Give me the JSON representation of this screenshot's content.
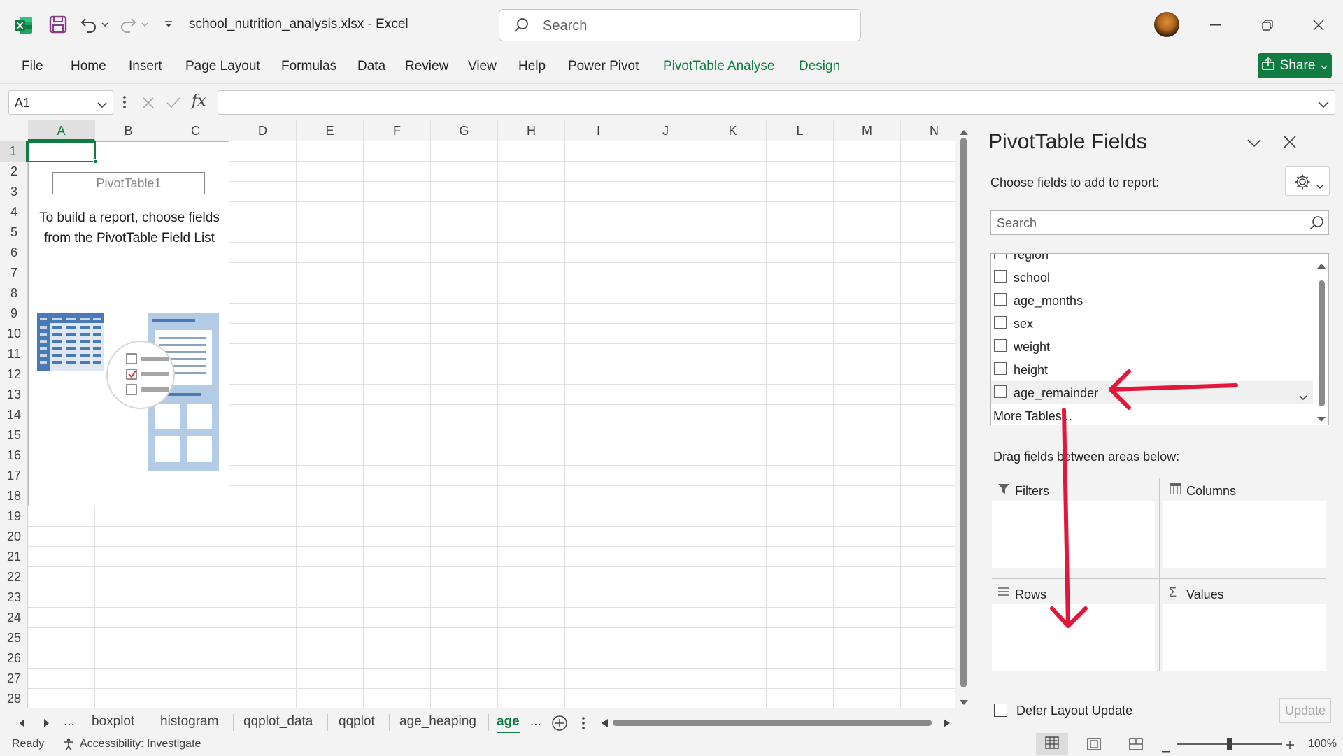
{
  "titlebar": {
    "file_title": "school_nutrition_analysis.xlsx  -  Excel",
    "search_placeholder": "Search",
    "icons": [
      "excel-logo-icon",
      "save-icon",
      "undo-icon",
      "redo-icon",
      "customize-qat-icon",
      "minimize-icon",
      "restore-icon",
      "close-icon"
    ]
  },
  "ribbon": {
    "tabs": [
      "File",
      "Home",
      "Insert",
      "Page Layout",
      "Formulas",
      "Data",
      "Review",
      "View",
      "Help",
      "Power Pivot"
    ],
    "context_tabs": [
      "PivotTable Analyse",
      "Design"
    ],
    "share_label": "Share",
    "accent_color": "#107c41"
  },
  "formula_bar": {
    "name_box": "A1",
    "fx_label": "fx",
    "formula": ""
  },
  "grid": {
    "columns": [
      "A",
      "B",
      "C",
      "D",
      "E",
      "F",
      "G",
      "H",
      "I",
      "J",
      "K",
      "L",
      "M",
      "N"
    ],
    "rows": [
      "1",
      "2",
      "3",
      "4",
      "5",
      "6",
      "7",
      "8",
      "9",
      "10",
      "11",
      "12",
      "13",
      "14",
      "15",
      "16",
      "17",
      "18",
      "19",
      "20",
      "21",
      "22",
      "23",
      "24",
      "25",
      "26",
      "27",
      "28"
    ],
    "selected_cell": "A1"
  },
  "pivot_placeholder": {
    "name": "PivotTable1",
    "instruction": "To build a report, choose fields from the PivotTable Field List"
  },
  "sheets": {
    "tabs": [
      "boxplot",
      "histogram",
      "qqplot_data",
      "qqplot",
      "age_heaping"
    ],
    "active": "age",
    "ellipsis_left": "...",
    "ellipsis_right": "..."
  },
  "status": {
    "ready": "Ready",
    "accessibility": "Accessibility: Investigate",
    "zoom": "100%"
  },
  "pane": {
    "title": "PivotTable Fields",
    "choose_label": "Choose fields to add to report:",
    "search_placeholder": "Search",
    "fields": [
      "region",
      "school",
      "age_months",
      "sex",
      "weight",
      "height",
      "age_remainder"
    ],
    "more_tables": "More Tables...",
    "drag_label": "Drag fields between areas below:",
    "areas": {
      "filters": "Filters",
      "columns": "Columns",
      "rows": "Rows",
      "values": "Values"
    },
    "defer_label": "Defer Layout Update",
    "update_label": "Update"
  },
  "annotation": {
    "arrow_color": "#e3173c"
  }
}
